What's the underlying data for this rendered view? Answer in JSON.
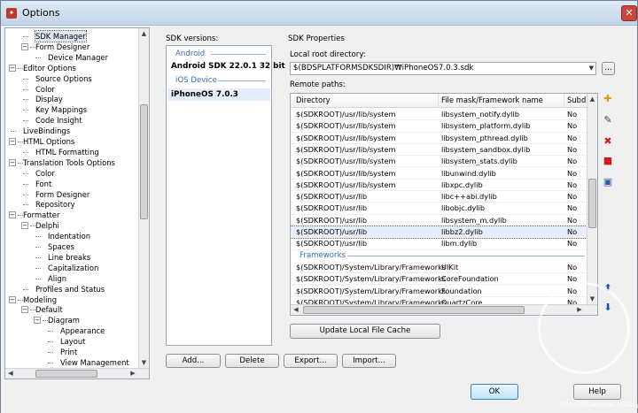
{
  "window": {
    "title": "Options",
    "close_glyph": "✕"
  },
  "tree": {
    "items": [
      {
        "label": "SDK Manager",
        "level": 2,
        "selected": true
      },
      {
        "label": "Form Designer",
        "level": 2,
        "expander": "-"
      },
      {
        "label": "Device Manager",
        "level": 3
      },
      {
        "label": "Editor Options",
        "level": 1,
        "expander": "-"
      },
      {
        "label": "Source Options",
        "level": 2
      },
      {
        "label": "Color",
        "level": 2
      },
      {
        "label": "Display",
        "level": 2
      },
      {
        "label": "Key Mappings",
        "level": 2
      },
      {
        "label": "Code Insight",
        "level": 2
      },
      {
        "label": "LiveBindings",
        "level": 1
      },
      {
        "label": "HTML Options",
        "level": 1,
        "expander": "-"
      },
      {
        "label": "HTML Formatting",
        "level": 2
      },
      {
        "label": "Translation Tools Options",
        "level": 1,
        "expander": "-"
      },
      {
        "label": "Color",
        "level": 2
      },
      {
        "label": "Font",
        "level": 2
      },
      {
        "label": "Form Designer",
        "level": 2
      },
      {
        "label": "Repository",
        "level": 2
      },
      {
        "label": "Formatter",
        "level": 1,
        "expander": "-"
      },
      {
        "label": "Delphi",
        "level": 2,
        "expander": "-"
      },
      {
        "label": "Indentation",
        "level": 3
      },
      {
        "label": "Spaces",
        "level": 3
      },
      {
        "label": "Line breaks",
        "level": 3
      },
      {
        "label": "Capitalization",
        "level": 3
      },
      {
        "label": "Align",
        "level": 3
      },
      {
        "label": "Profiles and Status",
        "level": 2
      },
      {
        "label": "Modeling",
        "level": 1,
        "expander": "-"
      },
      {
        "label": "Default",
        "level": 2,
        "expander": "-"
      },
      {
        "label": "Diagram",
        "level": 3,
        "expander": "-"
      },
      {
        "label": "Appearance",
        "level": 4
      },
      {
        "label": "Layout",
        "level": 4
      },
      {
        "label": "Print",
        "level": 4
      },
      {
        "label": "View Management",
        "level": 4
      }
    ]
  },
  "sdk_versions": {
    "label": "SDK versions:",
    "groups": [
      {
        "name": "Android",
        "items": [
          "Android SDK 22.0.1 32 bit"
        ]
      },
      {
        "name": "iOS Device",
        "items": [
          "iPhoneOS 7.0.3"
        ]
      }
    ],
    "selected": "iPhoneOS 7.0.3"
  },
  "sdk_properties": {
    "label": "SDK Properties",
    "local_root_label": "Local root directory:",
    "local_root_value": "$(BDSPLATFORMSDKSDIR)₩iPhoneOS7.0.3.sdk",
    "browse_label": "...",
    "remote_paths_label": "Remote paths:",
    "columns": [
      "Directory",
      "File mask/Framework name",
      "Subdi"
    ],
    "rows": [
      {
        "dir": "$(SDKROOT)/usr/lib/system",
        "mask": "libsystem_notify.dylib",
        "sub": "No"
      },
      {
        "dir": "$(SDKROOT)/usr/lib/system",
        "mask": "libsystem_platform.dylib",
        "sub": "No"
      },
      {
        "dir": "$(SDKROOT)/usr/lib/system",
        "mask": "libsystem_pthread.dylib",
        "sub": "No"
      },
      {
        "dir": "$(SDKROOT)/usr/lib/system",
        "mask": "libsystem_sandbox.dylib",
        "sub": "No"
      },
      {
        "dir": "$(SDKROOT)/usr/lib/system",
        "mask": "libsystem_stats.dylib",
        "sub": "No"
      },
      {
        "dir": "$(SDKROOT)/usr/lib/system",
        "mask": "libunwind.dylib",
        "sub": "No"
      },
      {
        "dir": "$(SDKROOT)/usr/lib/system",
        "mask": "libxpc.dylib",
        "sub": "No"
      },
      {
        "dir": "$(SDKROOT)/usr/lib",
        "mask": "libc++abi.dylib",
        "sub": "No"
      },
      {
        "dir": "$(SDKROOT)/usr/lib",
        "mask": "libobjc.dylib",
        "sub": "No"
      },
      {
        "dir": "$(SDKROOT)/usr/lib",
        "mask": "libsystem_m.dylib",
        "sub": "No"
      },
      {
        "dir": "$(SDKROOT)/usr/lib",
        "mask": "libbz2.dylib",
        "sub": "No",
        "selected": true
      },
      {
        "dir": "$(SDKROOT)/usr/lib",
        "mask": "libm.dylib",
        "sub": "No"
      },
      {
        "group": "Frameworks"
      },
      {
        "dir": "$(SDKROOT)/System/Library/Frameworks",
        "mask": "UIKit",
        "sub": "No"
      },
      {
        "dir": "$(SDKROOT)/System/Library/Frameworks",
        "mask": "CoreFoundation",
        "sub": "No"
      },
      {
        "dir": "$(SDKROOT)/System/Library/Frameworks",
        "mask": "Foundation",
        "sub": "No"
      },
      {
        "dir": "$(SDKROOT)/System/Library/Frameworks",
        "mask": "QuartzCore",
        "sub": "No"
      }
    ],
    "update_button": "Update Local File Cache"
  },
  "buttons": {
    "add": "Add...",
    "delete": "Delete",
    "export": "Export...",
    "import": "Import...",
    "ok": "OK",
    "help": "Help"
  },
  "side_icons": [
    "add-path-icon",
    "replace-path-icon",
    "delete-path-icon",
    "delete-all-icon",
    "save-icon",
    "move-up-icon",
    "move-down-icon"
  ],
  "watermark": "http://bluexmas.tistory.com",
  "colors": {
    "group_blue": "#3a6fb0",
    "selection": "#e5eefa"
  }
}
